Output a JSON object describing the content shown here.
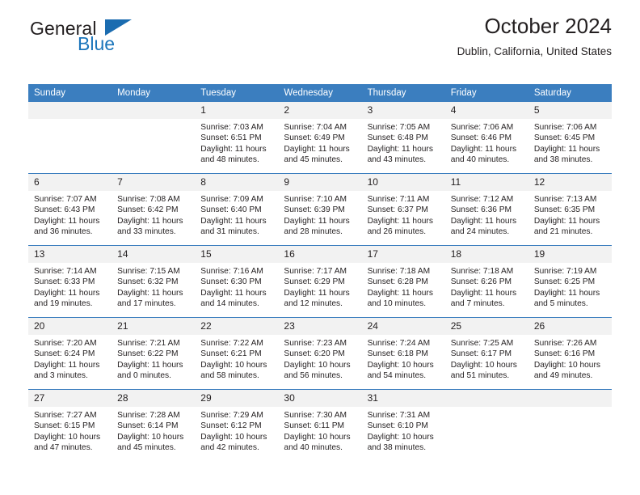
{
  "brand": {
    "name_part1": "General",
    "name_part2": "Blue",
    "triangle_icon": "triangle-icon",
    "accent_color": "#1b75bb"
  },
  "header": {
    "title": "October 2024",
    "location": "Dublin, California, United States"
  },
  "theme": {
    "header_blue": "#3b7ebf",
    "daynum_band": "#f2f2f2",
    "text": "#231f20"
  },
  "weekday_headers": [
    "Sunday",
    "Monday",
    "Tuesday",
    "Wednesday",
    "Thursday",
    "Friday",
    "Saturday"
  ],
  "labels": {
    "sunrise_prefix": "Sunrise:",
    "sunset_prefix": "Sunset:",
    "daylight_prefix": "Daylight:"
  },
  "weeks": [
    [
      {
        "day": "",
        "lines": [
          "",
          "",
          "",
          ""
        ]
      },
      {
        "day": "",
        "lines": [
          "",
          "",
          "",
          ""
        ]
      },
      {
        "day": "1",
        "lines": [
          "Sunrise: 7:03 AM",
          "Sunset: 6:51 PM",
          "Daylight: 11 hours",
          "and 48 minutes."
        ]
      },
      {
        "day": "2",
        "lines": [
          "Sunrise: 7:04 AM",
          "Sunset: 6:49 PM",
          "Daylight: 11 hours",
          "and 45 minutes."
        ]
      },
      {
        "day": "3",
        "lines": [
          "Sunrise: 7:05 AM",
          "Sunset: 6:48 PM",
          "Daylight: 11 hours",
          "and 43 minutes."
        ]
      },
      {
        "day": "4",
        "lines": [
          "Sunrise: 7:06 AM",
          "Sunset: 6:46 PM",
          "Daylight: 11 hours",
          "and 40 minutes."
        ]
      },
      {
        "day": "5",
        "lines": [
          "Sunrise: 7:06 AM",
          "Sunset: 6:45 PM",
          "Daylight: 11 hours",
          "and 38 minutes."
        ]
      }
    ],
    [
      {
        "day": "6",
        "lines": [
          "Sunrise: 7:07 AM",
          "Sunset: 6:43 PM",
          "Daylight: 11 hours",
          "and 36 minutes."
        ]
      },
      {
        "day": "7",
        "lines": [
          "Sunrise: 7:08 AM",
          "Sunset: 6:42 PM",
          "Daylight: 11 hours",
          "and 33 minutes."
        ]
      },
      {
        "day": "8",
        "lines": [
          "Sunrise: 7:09 AM",
          "Sunset: 6:40 PM",
          "Daylight: 11 hours",
          "and 31 minutes."
        ]
      },
      {
        "day": "9",
        "lines": [
          "Sunrise: 7:10 AM",
          "Sunset: 6:39 PM",
          "Daylight: 11 hours",
          "and 28 minutes."
        ]
      },
      {
        "day": "10",
        "lines": [
          "Sunrise: 7:11 AM",
          "Sunset: 6:37 PM",
          "Daylight: 11 hours",
          "and 26 minutes."
        ]
      },
      {
        "day": "11",
        "lines": [
          "Sunrise: 7:12 AM",
          "Sunset: 6:36 PM",
          "Daylight: 11 hours",
          "and 24 minutes."
        ]
      },
      {
        "day": "12",
        "lines": [
          "Sunrise: 7:13 AM",
          "Sunset: 6:35 PM",
          "Daylight: 11 hours",
          "and 21 minutes."
        ]
      }
    ],
    [
      {
        "day": "13",
        "lines": [
          "Sunrise: 7:14 AM",
          "Sunset: 6:33 PM",
          "Daylight: 11 hours",
          "and 19 minutes."
        ]
      },
      {
        "day": "14",
        "lines": [
          "Sunrise: 7:15 AM",
          "Sunset: 6:32 PM",
          "Daylight: 11 hours",
          "and 17 minutes."
        ]
      },
      {
        "day": "15",
        "lines": [
          "Sunrise: 7:16 AM",
          "Sunset: 6:30 PM",
          "Daylight: 11 hours",
          "and 14 minutes."
        ]
      },
      {
        "day": "16",
        "lines": [
          "Sunrise: 7:17 AM",
          "Sunset: 6:29 PM",
          "Daylight: 11 hours",
          "and 12 minutes."
        ]
      },
      {
        "day": "17",
        "lines": [
          "Sunrise: 7:18 AM",
          "Sunset: 6:28 PM",
          "Daylight: 11 hours",
          "and 10 minutes."
        ]
      },
      {
        "day": "18",
        "lines": [
          "Sunrise: 7:18 AM",
          "Sunset: 6:26 PM",
          "Daylight: 11 hours",
          "and 7 minutes."
        ]
      },
      {
        "day": "19",
        "lines": [
          "Sunrise: 7:19 AM",
          "Sunset: 6:25 PM",
          "Daylight: 11 hours",
          "and 5 minutes."
        ]
      }
    ],
    [
      {
        "day": "20",
        "lines": [
          "Sunrise: 7:20 AM",
          "Sunset: 6:24 PM",
          "Daylight: 11 hours",
          "and 3 minutes."
        ]
      },
      {
        "day": "21",
        "lines": [
          "Sunrise: 7:21 AM",
          "Sunset: 6:22 PM",
          "Daylight: 11 hours",
          "and 0 minutes."
        ]
      },
      {
        "day": "22",
        "lines": [
          "Sunrise: 7:22 AM",
          "Sunset: 6:21 PM",
          "Daylight: 10 hours",
          "and 58 minutes."
        ]
      },
      {
        "day": "23",
        "lines": [
          "Sunrise: 7:23 AM",
          "Sunset: 6:20 PM",
          "Daylight: 10 hours",
          "and 56 minutes."
        ]
      },
      {
        "day": "24",
        "lines": [
          "Sunrise: 7:24 AM",
          "Sunset: 6:18 PM",
          "Daylight: 10 hours",
          "and 54 minutes."
        ]
      },
      {
        "day": "25",
        "lines": [
          "Sunrise: 7:25 AM",
          "Sunset: 6:17 PM",
          "Daylight: 10 hours",
          "and 51 minutes."
        ]
      },
      {
        "day": "26",
        "lines": [
          "Sunrise: 7:26 AM",
          "Sunset: 6:16 PM",
          "Daylight: 10 hours",
          "and 49 minutes."
        ]
      }
    ],
    [
      {
        "day": "27",
        "lines": [
          "Sunrise: 7:27 AM",
          "Sunset: 6:15 PM",
          "Daylight: 10 hours",
          "and 47 minutes."
        ]
      },
      {
        "day": "28",
        "lines": [
          "Sunrise: 7:28 AM",
          "Sunset: 6:14 PM",
          "Daylight: 10 hours",
          "and 45 minutes."
        ]
      },
      {
        "day": "29",
        "lines": [
          "Sunrise: 7:29 AM",
          "Sunset: 6:12 PM",
          "Daylight: 10 hours",
          "and 42 minutes."
        ]
      },
      {
        "day": "30",
        "lines": [
          "Sunrise: 7:30 AM",
          "Sunset: 6:11 PM",
          "Daylight: 10 hours",
          "and 40 minutes."
        ]
      },
      {
        "day": "31",
        "lines": [
          "Sunrise: 7:31 AM",
          "Sunset: 6:10 PM",
          "Daylight: 10 hours",
          "and 38 minutes."
        ]
      },
      {
        "day": "",
        "lines": [
          "",
          "",
          "",
          ""
        ]
      },
      {
        "day": "",
        "lines": [
          "",
          "",
          "",
          ""
        ]
      }
    ]
  ]
}
